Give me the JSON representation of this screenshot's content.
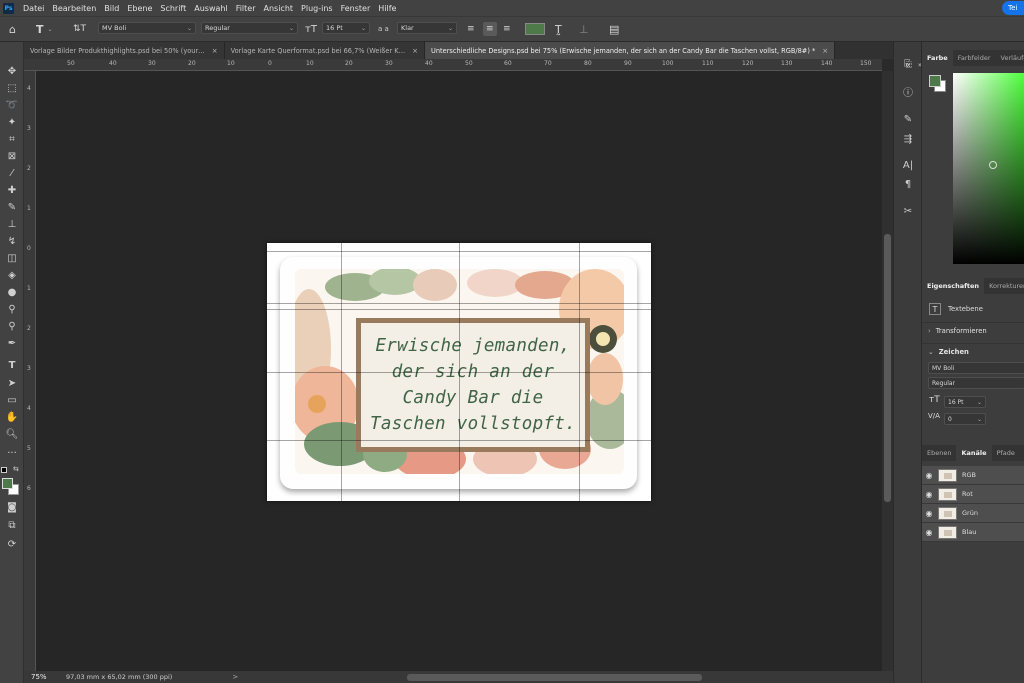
{
  "menubar": {
    "logo": "Ps",
    "items": [
      "Datei",
      "Bearbeiten",
      "Bild",
      "Ebene",
      "Schrift",
      "Auswahl",
      "Filter",
      "Ansicht",
      "Plug-ins",
      "Fenster",
      "Hilfe"
    ],
    "share_label": "Tei"
  },
  "options": {
    "font_family": "MV Boli",
    "font_style": "Regular",
    "font_size": "16 Pt",
    "antialias": "Klar",
    "aa_label": "a a",
    "text_color": "#4e7a4a"
  },
  "tabs": [
    {
      "label": "Vorlage Bilder Produkthighlights.psd bei 50% (your…",
      "close": "×"
    },
    {
      "label": "Vorlage Karte Querformat.psd bei 66,7% (Weißer K…",
      "close": "×"
    },
    {
      "label": "Unterschiedliche Designs.psd bei 75% (Erwische jemanden, der sich an der Candy Bar die Taschen vollst, RGB/8#) *",
      "close": "×"
    }
  ],
  "ruler": {
    "h_labels": [
      "50",
      "40",
      "30",
      "20",
      "10",
      "0",
      "10",
      "20",
      "30",
      "40",
      "50",
      "60",
      "70",
      "80",
      "90",
      "100",
      "110",
      "120",
      "130",
      "140",
      "150"
    ],
    "v_labels": [
      "4",
      "3",
      "2",
      "1",
      "0",
      "1",
      "2",
      "3",
      "4",
      "5",
      "6"
    ]
  },
  "card": {
    "lines": [
      "Erwische jemanden,",
      "der sich an der",
      "Candy Bar die",
      "Taschen vollstopft."
    ]
  },
  "status": {
    "zoom": "75%",
    "doc_info": "97,03 mm x 65,02 mm (300 ppi)",
    "arrow": ">"
  },
  "panels": {
    "color_tabs": [
      "Farbe",
      "Farbfelder",
      "Verläufe"
    ],
    "foreground_color": "#4e7a4a",
    "properties_tabs": [
      "Eigenschaften",
      "Korrekturen"
    ],
    "layer_kind": "Textebene",
    "transform_label": "Transformieren",
    "character_label": "Zeichen",
    "font_family": "MV Boli",
    "font_style": "Regular",
    "font_size": "16 Pt",
    "tracking": "0",
    "layers_tabs": [
      "Ebenen",
      "Kanäle",
      "Pfade"
    ],
    "channels": [
      "RGB",
      "Rot",
      "Grün",
      "Blau"
    ]
  }
}
